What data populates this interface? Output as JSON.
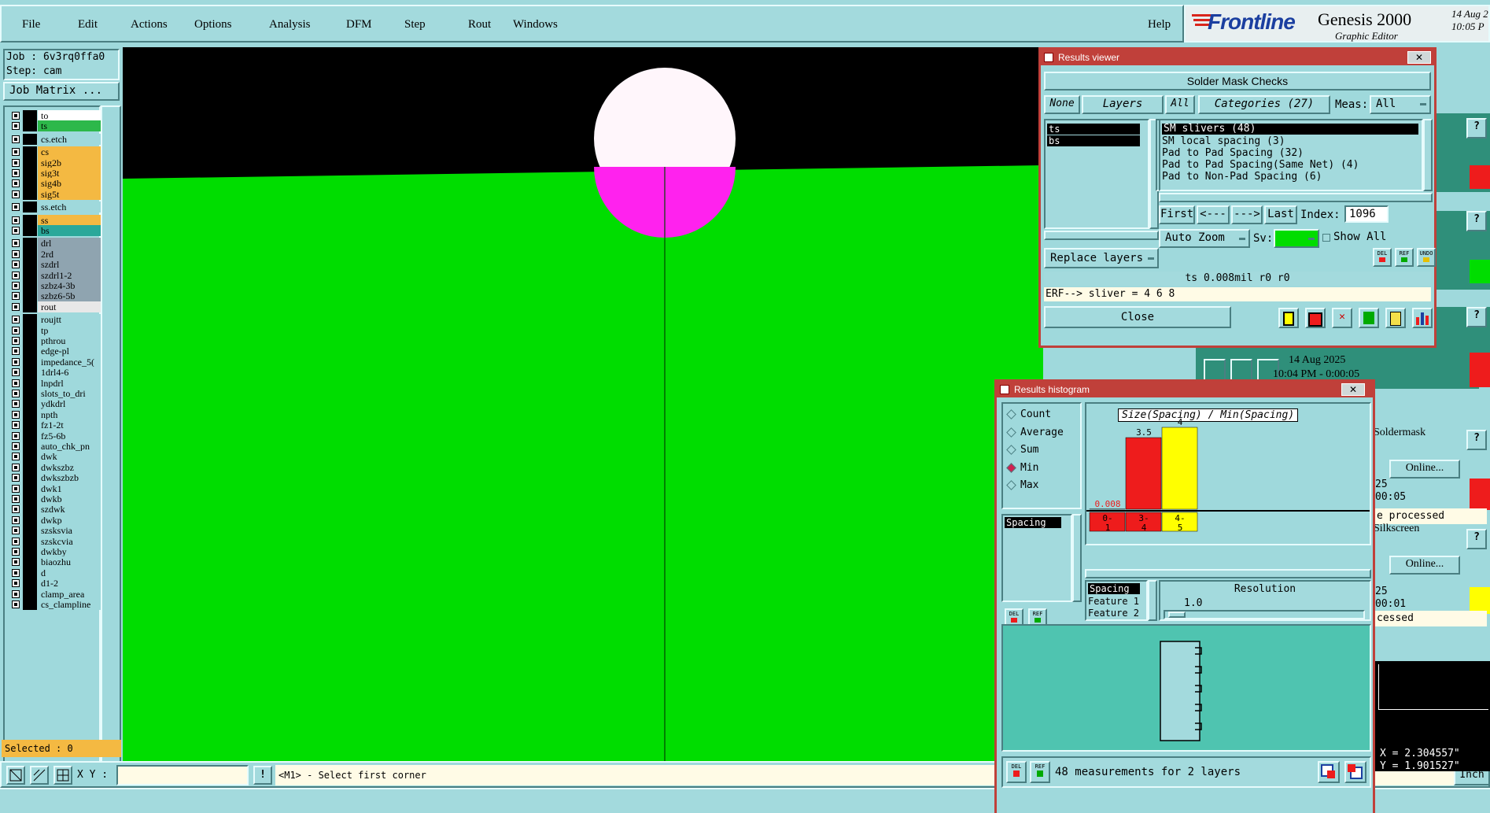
{
  "menubar": {
    "items": [
      "File",
      "Edit",
      "Actions",
      "Options",
      "Analysis",
      "DFM",
      "Step",
      "Rout",
      "Windows"
    ],
    "help": "Help"
  },
  "brand": {
    "logo": "Frontline",
    "product": "Genesis 2000",
    "subtitle": "Graphic Editor",
    "date": "14 Aug 2",
    "time": "10:05 P"
  },
  "job": {
    "job_label": "Job : 6v3rq0ffa0",
    "step_label": "Step: cam",
    "matrix_button": "Job Matrix ...",
    "selected": "Selected : 0"
  },
  "layers": [
    {
      "name": "to",
      "color": "#ffffff",
      "group": 0
    },
    {
      "name": "ts",
      "color": "#2db84a",
      "group": 0
    },
    {
      "name": "cs.etch",
      "color": "#9fd9dc",
      "group": 1
    },
    {
      "name": "cs",
      "color": "#f4b942",
      "group": 2
    },
    {
      "name": "sig2b",
      "color": "#f4b942",
      "group": 2
    },
    {
      "name": "sig3t",
      "color": "#f4b942",
      "group": 2
    },
    {
      "name": "sig4b",
      "color": "#f4b942",
      "group": 2
    },
    {
      "name": "sig5t",
      "color": "#f4b942",
      "group": 2
    },
    {
      "name": "ss.etch",
      "color": "#9fd9dc",
      "group": 3
    },
    {
      "name": "ss",
      "color": "#f4b942",
      "group": 4
    },
    {
      "name": "bs",
      "color": "#2aa89a",
      "group": 4
    },
    {
      "name": "drl",
      "color": "#8fa4b0",
      "group": 5
    },
    {
      "name": "2rd",
      "color": "#8fa4b0",
      "group": 5
    },
    {
      "name": "szdrl",
      "color": "#8fa4b0",
      "group": 5
    },
    {
      "name": "szdrl1-2",
      "color": "#8fa4b0",
      "group": 5
    },
    {
      "name": "szbz4-3b",
      "color": "#8fa4b0",
      "group": 5
    },
    {
      "name": "szbz6-5b",
      "color": "#8fa4b0",
      "group": 5
    },
    {
      "name": "rout",
      "color": "#e8e8e8",
      "group": 5
    },
    {
      "name": "roujtt",
      "color": "#9fd9dc",
      "group": 6
    },
    {
      "name": "tp",
      "color": "#9fd9dc",
      "group": 6
    },
    {
      "name": "pthrou",
      "color": "#9fd9dc",
      "group": 6
    },
    {
      "name": "edge-pl",
      "color": "#9fd9dc",
      "group": 6
    },
    {
      "name": "impedance_5(",
      "color": "#9fd9dc",
      "group": 6
    },
    {
      "name": "1drl4-6",
      "color": "#9fd9dc",
      "group": 6
    },
    {
      "name": "lnpdrl",
      "color": "#9fd9dc",
      "group": 6
    },
    {
      "name": "slots_to_dri",
      "color": "#9fd9dc",
      "group": 6
    },
    {
      "name": "ydkdrl",
      "color": "#9fd9dc",
      "group": 6
    },
    {
      "name": "npth",
      "color": "#9fd9dc",
      "group": 6
    },
    {
      "name": "fz1-2t",
      "color": "#9fd9dc",
      "group": 6
    },
    {
      "name": "fz5-6b",
      "color": "#9fd9dc",
      "group": 6
    },
    {
      "name": "auto_chk_pn",
      "color": "#9fd9dc",
      "group": 6
    },
    {
      "name": "dwk",
      "color": "#9fd9dc",
      "group": 6
    },
    {
      "name": "dwkszbz",
      "color": "#9fd9dc",
      "group": 6
    },
    {
      "name": "dwkszbzb",
      "color": "#9fd9dc",
      "group": 6
    },
    {
      "name": "dwk1",
      "color": "#9fd9dc",
      "group": 6
    },
    {
      "name": "dwkb",
      "color": "#9fd9dc",
      "group": 6
    },
    {
      "name": "szdwk",
      "color": "#9fd9dc",
      "group": 6
    },
    {
      "name": "dwkp",
      "color": "#9fd9dc",
      "group": 6
    },
    {
      "name": "szsksvia",
      "color": "#9fd9dc",
      "group": 6
    },
    {
      "name": "szskcvia",
      "color": "#9fd9dc",
      "group": 6
    },
    {
      "name": "dwkby",
      "color": "#9fd9dc",
      "group": 6
    },
    {
      "name": "biaozhu",
      "color": "#9fd9dc",
      "group": 6
    },
    {
      "name": "d",
      "color": "#9fd9dc",
      "group": 6
    },
    {
      "name": "d1-2",
      "color": "#9fd9dc",
      "group": 6
    },
    {
      "name": "clamp_area",
      "color": "#9fd9dc",
      "group": 6
    },
    {
      "name": "cs_clampline",
      "color": "#9fd9dc",
      "group": 6
    }
  ],
  "statusbar": {
    "xy_label": "X Y :",
    "xy_value": "",
    "prompt": "<M1> - Select first corner",
    "unit": "Inch"
  },
  "results_viewer": {
    "title": "Results viewer",
    "header": "Solder Mask Checks",
    "none_btn": "None",
    "layers_btn": "Layers",
    "all_btn": "All",
    "categories_btn": "Categories (27)",
    "meas_label": "Meas:",
    "meas_value": "All",
    "layers": [
      "ts",
      "bs"
    ],
    "categories": [
      "SM slivers (48)",
      "SM local spacing (3)",
      "Pad to Pad Spacing (32)",
      "Pad to Pad Spacing(Same Net) (4)",
      "Pad to Non-Pad Spacing (6)"
    ],
    "first_btn": "First",
    "prev_btn": "<---",
    "next_btn": "--->",
    "last_btn": "Last",
    "index_label": "Index:",
    "index_value": "1096",
    "auto_zoom": "Auto Zoom",
    "sv_label": "Sv:",
    "show_all": "Show All",
    "replace_layers": "Replace layers",
    "del_label": "DEL",
    "ref_label": "REF",
    "undo_label": "UNDO",
    "measure_line": "ts 0.008mil  r0  r0",
    "erf_line": "ERF--> sliver = 4 6 8",
    "close_btn": "Close"
  },
  "histogram": {
    "title": "Results histogram",
    "radio": [
      "Count",
      "Average",
      "Sum",
      "Min",
      "Max"
    ],
    "radio_selected": "Min",
    "list_item": "Spacing",
    "chart_title": "Size(Spacing) / Min(Spacing)",
    "bottom_list": [
      "Spacing",
      "Feature 1",
      "Feature 2"
    ],
    "resolution_label": "Resolution",
    "resolution_value": "1.0",
    "footer_text": "48 measurements for 2 layers",
    "del_label": "DEL",
    "ref_label": "REF"
  },
  "chart_data": {
    "type": "bar",
    "title": "Size(Spacing) / Min(Spacing)",
    "categories": [
      "0-1",
      "3-4",
      "4-5"
    ],
    "values": [
      0.008,
      3.5,
      4
    ],
    "labels": [
      "0.008",
      "3.5",
      "4"
    ],
    "colors": [
      "#ee1c1c",
      "#ee1c1c",
      "#ffff00"
    ]
  },
  "right_panel": {
    "date": "14 Aug 2025",
    "time": "10:04 PM - 0:00:05",
    "item1_title": "Soldermask",
    "item1_status": "Online...",
    "item1_time": "25",
    "item1_elapsed": "00:05",
    "item1_note": "e processed",
    "item2_title": "Silkscreen",
    "item2_status": "Online...",
    "item2_time": "25",
    "item2_elapsed": "00:01",
    "item2_note": "cessed",
    "help_glyph": "?",
    "coord_x": "X = 2.304557\"",
    "coord_y": "Y = 1.901527\""
  }
}
